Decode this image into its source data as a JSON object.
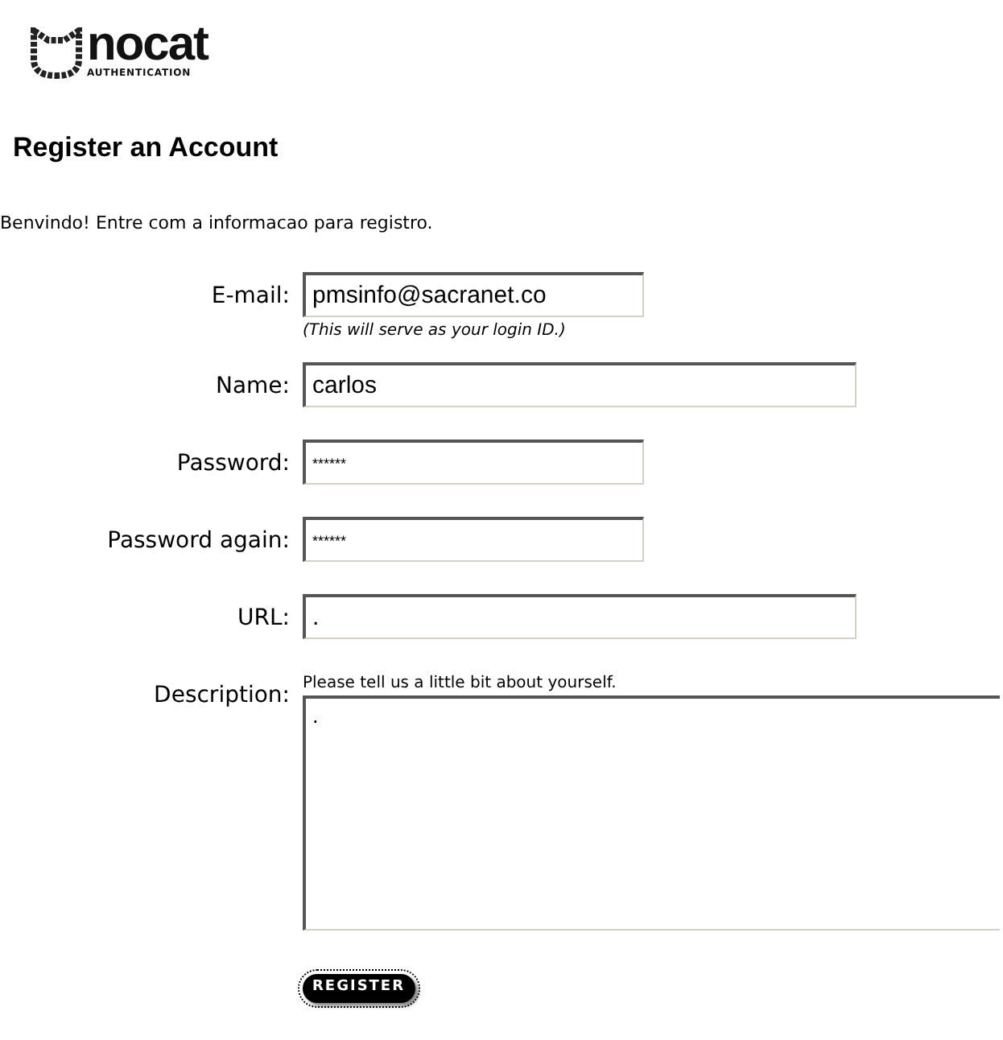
{
  "logo": {
    "name": "nocat",
    "tagline": "AUTHENTICATION"
  },
  "title": "Register an Account",
  "intro": "Benvindo! Entre com a informacao para registro.",
  "fields": [
    {
      "kind": "short",
      "label": "E-mail:",
      "value": "pmsinfo@sacranet.co",
      "hint": "(This will serve as your login ID.)"
    },
    {
      "kind": "long",
      "label": "Name:",
      "value": "carlos"
    },
    {
      "kind": "password",
      "label": "Password:",
      "value": "******"
    },
    {
      "kind": "password",
      "label": "Password again:",
      "value": "******"
    },
    {
      "kind": "long",
      "label": "URL:",
      "value": "."
    },
    {
      "kind": "textarea",
      "label": "Description:",
      "value": ".",
      "prompt": "Please tell us a little bit about yourself."
    }
  ],
  "submit": {
    "label": "REGISTER"
  }
}
